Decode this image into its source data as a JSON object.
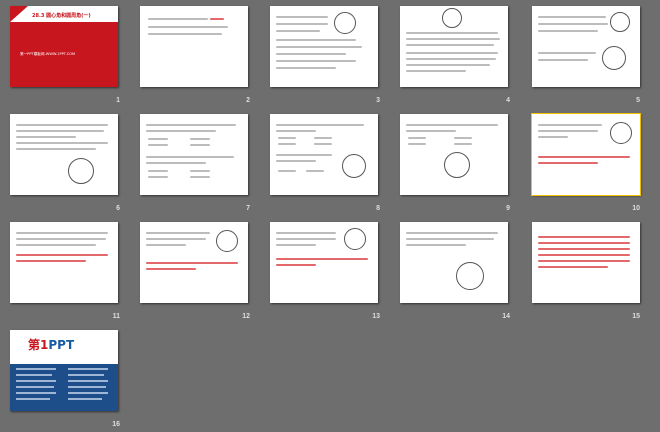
{
  "slides": [
    {
      "n": "1",
      "title": "28.3 圆心角和圆周角(一)",
      "subtitle": "第一PPT模板网-WWW.1PPT.COM"
    },
    {
      "n": "2"
    },
    {
      "n": "3"
    },
    {
      "n": "4"
    },
    {
      "n": "5"
    },
    {
      "n": "6"
    },
    {
      "n": "7"
    },
    {
      "n": "8"
    },
    {
      "n": "9"
    },
    {
      "n": "10"
    },
    {
      "n": "11"
    },
    {
      "n": "12"
    },
    {
      "n": "13"
    },
    {
      "n": "14"
    },
    {
      "n": "15"
    },
    {
      "n": "16",
      "logo_main": "第",
      "logo_num": "1",
      "logo_rest": "PPT"
    }
  ],
  "colors": {
    "background": "#6e6e6e",
    "title_red": "#c8161e",
    "answer_red": "#e2686c",
    "logo_blue": "#1a5aa0"
  }
}
